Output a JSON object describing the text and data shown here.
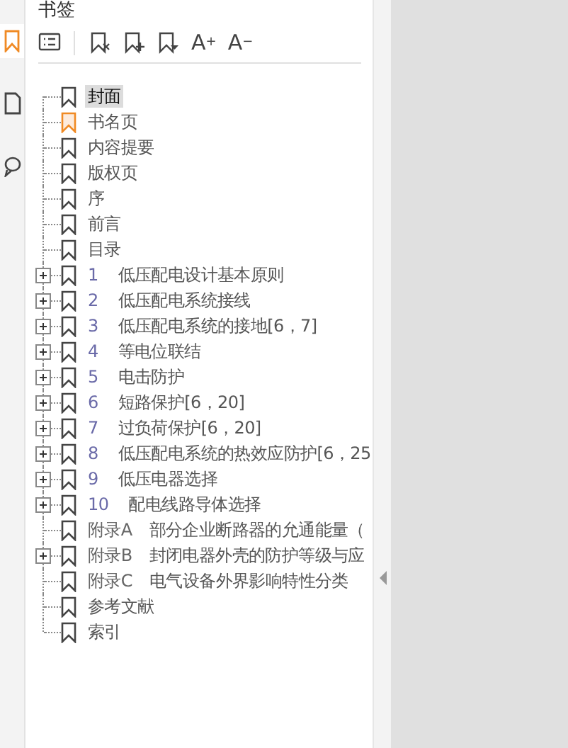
{
  "side_tabs": [
    {
      "kind": "bookmarks",
      "selected": true
    },
    {
      "kind": "pages",
      "selected": false
    },
    {
      "kind": "comments",
      "selected": false
    }
  ],
  "panel": {
    "title": "书签",
    "toolbar": [
      {
        "kind": "list"
      },
      {
        "kind": "separator"
      },
      {
        "kind": "delete"
      },
      {
        "kind": "add"
      },
      {
        "kind": "down"
      },
      {
        "kind": "text",
        "label": "A$^{+}$"
      },
      {
        "kind": "text",
        "label": "A$^{−}$"
      }
    ]
  },
  "bookmarks": [
    {
      "kind": "leaf",
      "title": "封面",
      "selected": true,
      "current": false
    },
    {
      "kind": "leaf",
      "title": "书名页",
      "selected": false,
      "current": true
    },
    {
      "kind": "leaf",
      "title": "内容提要",
      "selected": false,
      "current": false
    },
    {
      "kind": "leaf",
      "title": "版权页",
      "selected": false,
      "current": false
    },
    {
      "kind": "leaf",
      "title": "序",
      "selected": false,
      "current": false
    },
    {
      "kind": "leaf",
      "title": "前言",
      "selected": false,
      "current": false
    },
    {
      "kind": "leaf",
      "title": "目录",
      "selected": false,
      "current": false
    },
    {
      "kind": "branch",
      "expanded": false,
      "number": "1",
      "title": "低压配电设计基本原则",
      "selected": false,
      "current": false
    },
    {
      "kind": "branch",
      "expanded": false,
      "number": "2",
      "title": "低压配电系统接线",
      "selected": false,
      "current": false
    },
    {
      "kind": "branch",
      "expanded": false,
      "number": "3",
      "title": "低压配电系统的接地[6，7]",
      "selected": false,
      "current": false
    },
    {
      "kind": "branch",
      "expanded": false,
      "number": "4",
      "title": "等电位联结",
      "selected": false,
      "current": false
    },
    {
      "kind": "branch",
      "expanded": false,
      "number": "5",
      "title": "电击防护",
      "selected": false,
      "current": false
    },
    {
      "kind": "branch",
      "expanded": false,
      "number": "6",
      "title": "短路保护[6，20]",
      "selected": false,
      "current": false
    },
    {
      "kind": "branch",
      "expanded": false,
      "number": "7",
      "title": "过负荷保护[6，20]",
      "selected": false,
      "current": false
    },
    {
      "kind": "branch",
      "expanded": false,
      "number": "8",
      "title": "低压配电系统的热效应防护[6，25",
      "selected": false,
      "current": false
    },
    {
      "kind": "branch",
      "expanded": false,
      "number": "9",
      "title": "低压电器选择",
      "selected": false,
      "current": false
    },
    {
      "kind": "branch",
      "expanded": false,
      "number": "10",
      "title": "配电线路导体选择",
      "selected": false,
      "current": false
    },
    {
      "kind": "leaf",
      "number": "附录A",
      "title": "部分企业断路器的允通能量（",
      "selected": false,
      "current": false
    },
    {
      "kind": "branch",
      "expanded": false,
      "number": "附录B",
      "title": "封闭电器外壳的防护等级与应",
      "selected": false,
      "current": false
    },
    {
      "kind": "leaf",
      "number": "附录C",
      "title": "电气设备外界影响特性分类",
      "selected": false,
      "current": false
    },
    {
      "kind": "leaf",
      "title": "参考文献",
      "selected": false,
      "current": false
    },
    {
      "kind": "leaf",
      "title": "索引",
      "selected": false,
      "current": false
    }
  ]
}
